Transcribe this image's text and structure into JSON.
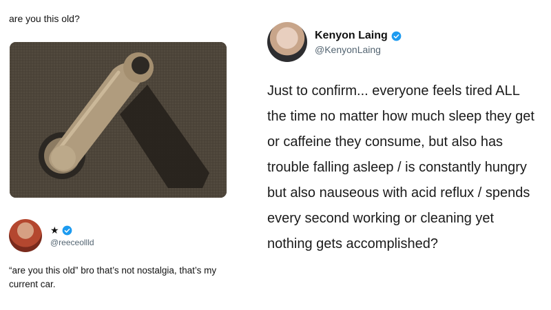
{
  "left": {
    "caption": "are you this old?",
    "tweet": {
      "name": "★",
      "handle": "@reeceollld",
      "text": "“are you this old” bro that’s not nostalgia, that’s my current car."
    }
  },
  "right": {
    "tweet": {
      "name": "Kenyon Laing",
      "handle": "@KenyonLaing",
      "text": "Just to confirm... everyone feels tired ALL the time no matter how much sleep they get or caffeine they consume, but also has trouble falling asleep / is constantly hungry but also nauseous with acid reflux / spends every second working or cleaning yet nothing gets accomplished?"
    }
  },
  "colors": {
    "verified": "#1d9bf0",
    "handle": "#536471",
    "crank": "#b09c7e"
  },
  "icons": {
    "verified": "verified-badge-icon"
  }
}
